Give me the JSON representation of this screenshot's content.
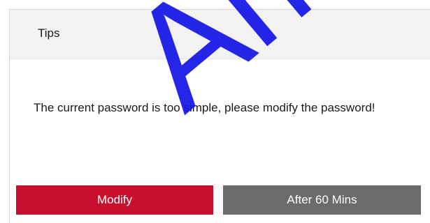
{
  "dialog": {
    "title": "Tips",
    "message": "The current password is too simple, please modify the password!",
    "buttons": {
      "modify_label": "Modify",
      "later_label": "After 60 Mins"
    }
  },
  "watermark": {
    "text": "Am"
  },
  "colors": {
    "primary_button": "#c8102e",
    "secondary_button": "#6b6b6b",
    "header_background": "#f2f2f2",
    "watermark": "#1414e6"
  }
}
